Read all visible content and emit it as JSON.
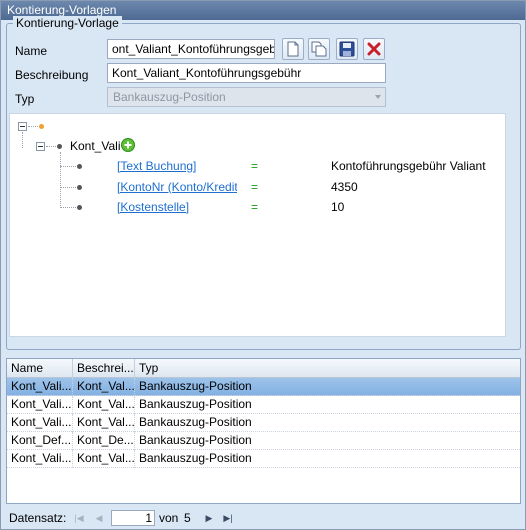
{
  "window": {
    "title": "Kontierung-Vorlagen"
  },
  "group": {
    "label": "Kontierung-Vorlage"
  },
  "form": {
    "name_label": "Name",
    "name_value": "ont_Valiant_Kontoführungsgebühr",
    "desc_label": "Beschreibung",
    "desc_value": "Kont_Valiant_Kontoführungsgebühr",
    "type_label": "Typ",
    "type_value": "Bankauszug-Position"
  },
  "toolbar": {
    "icons": [
      "new-document-icon",
      "copy-icon",
      "save-icon",
      "delete-icon"
    ],
    "delete_color": "#c8202a"
  },
  "tree": {
    "node_label": "Kont_Vali",
    "items": [
      {
        "field": "[Text Buchung]",
        "op": "=",
        "value": "Kontoführungsgebühr Valiant"
      },
      {
        "field": "[KontoNr (Konto/Kreditor",
        "op": "=",
        "value": "4350"
      },
      {
        "field": "[Kostenstelle]",
        "op": "=",
        "value": "10"
      }
    ]
  },
  "grid": {
    "columns": [
      "Name",
      "Beschrei...",
      "Typ"
    ],
    "rows": [
      [
        "Kont_Vali...",
        "Kont_Val...",
        "Bankauszug-Position"
      ],
      [
        "Kont_Vali...",
        "Kont_Val...",
        "Bankauszug-Position"
      ],
      [
        "Kont_Vali...",
        "Kont_Val...",
        "Bankauszug-Position"
      ],
      [
        "Kont_Def...",
        "Kont_De...",
        "Bankauszug-Position"
      ],
      [
        "Kont_Vali...",
        "Kont_Val...",
        "Bankauszug-Position"
      ]
    ],
    "selected_row": 0
  },
  "navigator": {
    "label": "Datensatz:",
    "current": "1",
    "of_label": "von",
    "total": "5"
  },
  "colors": {
    "selection": "#8fb9e6",
    "link": "#1e6fd0",
    "equals": "#1a9a1a"
  }
}
